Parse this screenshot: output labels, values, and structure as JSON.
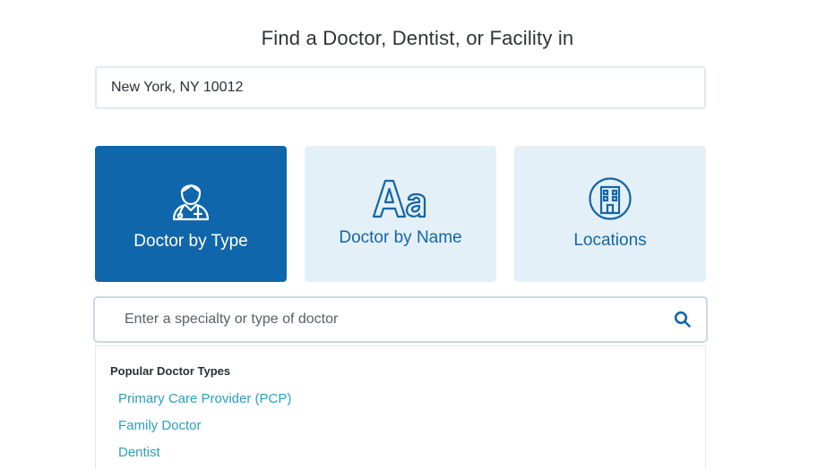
{
  "heading": "Find a Doctor, Dentist, or Facility in",
  "location": {
    "value": "New York, NY 10012"
  },
  "tiles": [
    {
      "label": "Doctor by Type",
      "icon": "doctor-icon",
      "active": true
    },
    {
      "label": "Doctor by Name",
      "icon": "text-aa-icon",
      "active": false
    },
    {
      "label": "Locations",
      "icon": "building-icon",
      "active": false
    }
  ],
  "specialty_search": {
    "placeholder": "Enter a specialty or type of doctor",
    "icon": "search-icon"
  },
  "dropdown": {
    "heading": "Popular Doctor Types",
    "items": [
      "Primary Care Provider (PCP)",
      "Family Doctor",
      "Dentist"
    ]
  },
  "colors": {
    "active_tile": "#0f66aa",
    "inactive_tile": "#e4f0f7",
    "tile_text": "#1466a8",
    "link": "#2a9fbf"
  }
}
